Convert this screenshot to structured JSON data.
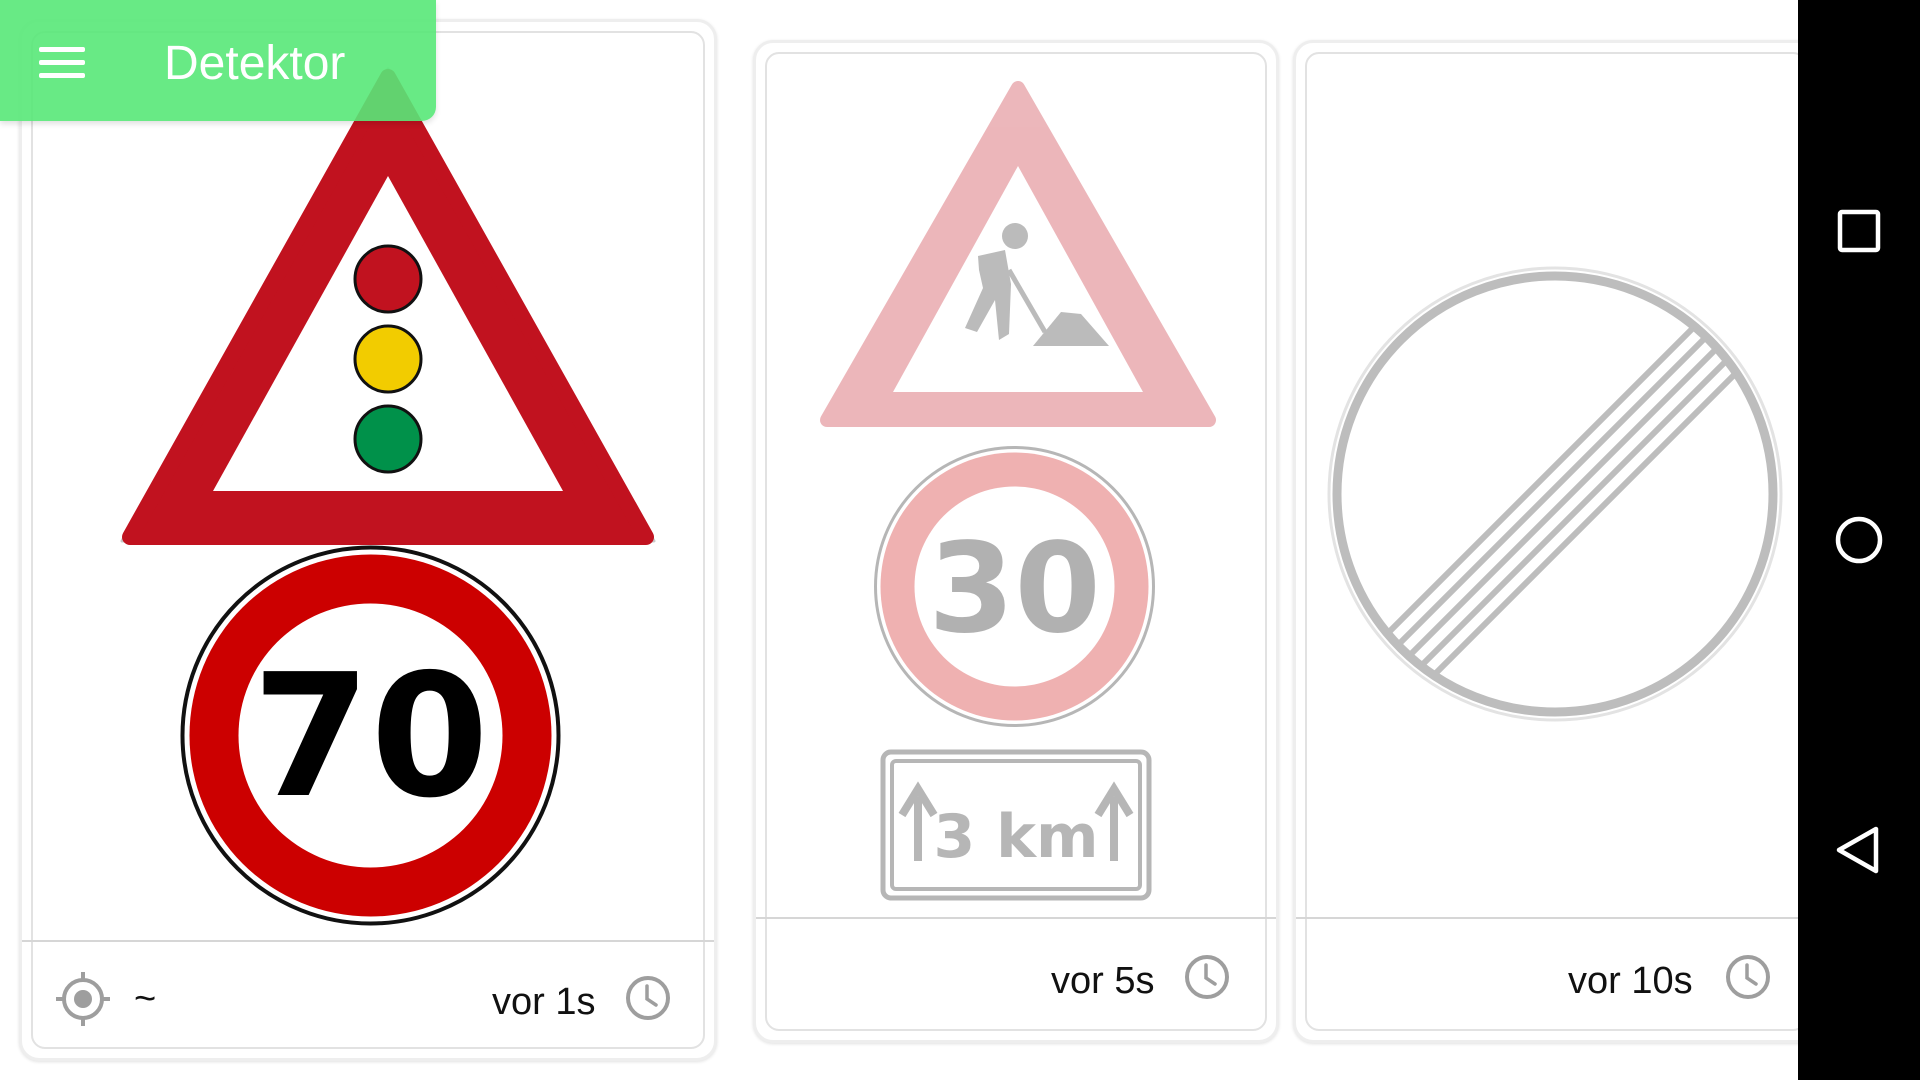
{
  "appbar": {
    "title": "Detektor",
    "menu_icon": "hamburger-menu-icon",
    "color": "#58e878"
  },
  "cards": [
    {
      "signs": [
        "traffic-light-warning-sign",
        "speed-limit-sign"
      ],
      "speed_limit": "70",
      "location_value": "~",
      "time": "vor 1s",
      "active": true
    },
    {
      "signs": [
        "road-works-sign",
        "speed-limit-sign",
        "distance-plate-sign"
      ],
      "speed_limit": "30",
      "distance": "3 km",
      "time": "vor 5s",
      "active": false
    },
    {
      "signs": [
        "end-of-all-restrictions-sign"
      ],
      "time": "vor 10s",
      "active": false
    }
  ],
  "colors": {
    "sign_red": "#c1121f",
    "limit_red": "#cc0000",
    "amber": "#f2cc00",
    "green": "#00914a"
  },
  "navbar": {
    "buttons": [
      "recents-icon",
      "home-icon",
      "back-icon"
    ]
  }
}
